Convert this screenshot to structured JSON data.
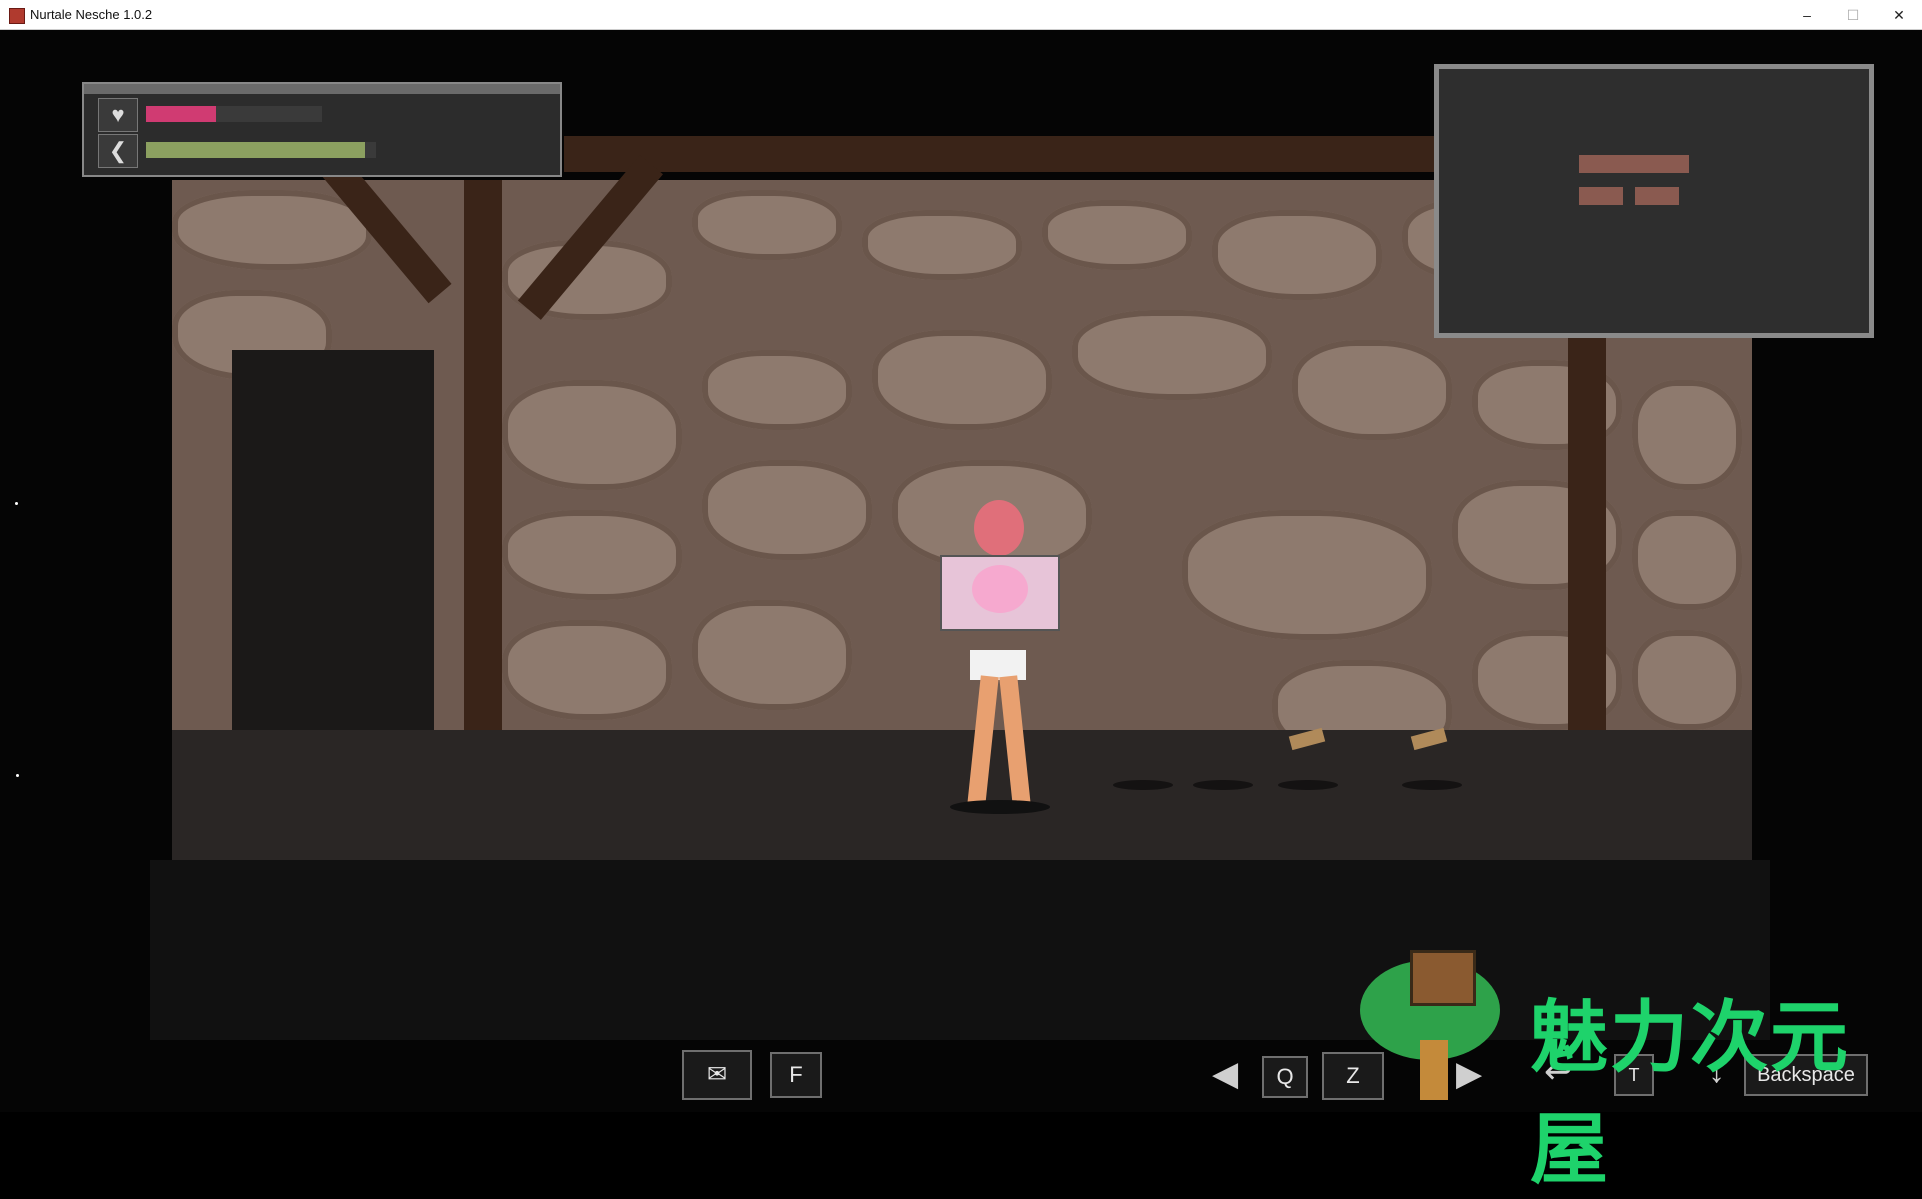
{
  "window": {
    "title": "Nurtale Nesche 1.0.2",
    "minimize": "–",
    "maximize": "☐",
    "close": "✕"
  },
  "hud": {
    "health_icon": "heart-icon",
    "stamina_icon": "wing-icon",
    "health_fraction": 0.4,
    "stamina_fraction": 0.95
  },
  "controls": {
    "map_key": "✉",
    "interact_key": "F",
    "q_key": "Q",
    "z_key": "Z",
    "t_key": "T",
    "backspace_key": "Backspace"
  },
  "watermark": {
    "text": "魅力次元屋"
  },
  "colors": {
    "health": "#d03b72",
    "stamina": "#8ca060",
    "accent": "#1ed36b"
  }
}
